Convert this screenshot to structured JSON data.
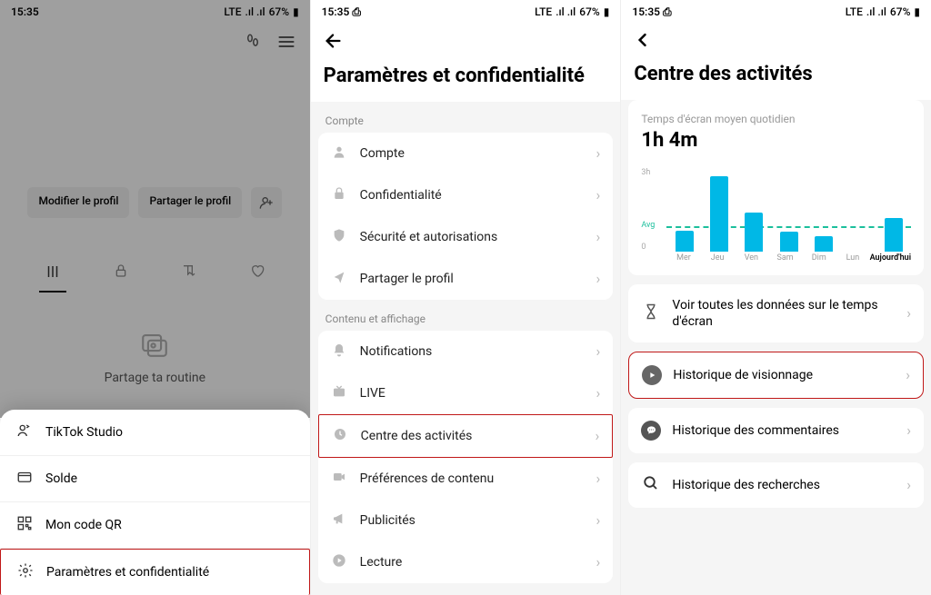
{
  "status": {
    "time": "15:35",
    "time_with_icon": "15:35 ⎙",
    "lte": "LTE",
    "battery": "67%",
    "battery_icon": "▮"
  },
  "panel1": {
    "edit_profile": "Modifier le profil",
    "share_profile": "Partager le profil",
    "tagline": "Partage ta routine",
    "studio": "TikTok Studio",
    "balance": "Solde",
    "qr": "Mon code QR",
    "settings": "Paramètres et confidentialité"
  },
  "panel2": {
    "title": "Paramètres et confidentialité",
    "section_account": "Compte",
    "items_account": [
      "Compte",
      "Confidentialité",
      "Sécurité et autorisations",
      "Partager le profil"
    ],
    "section_content": "Contenu et affichage",
    "items_content": [
      "Notifications",
      "LIVE",
      "Centre des activités",
      "Préférences de contenu",
      "Publicités",
      "Lecture"
    ]
  },
  "panel3": {
    "title": "Centre des activités",
    "avg_label": "Temps d'écran moyen quotidien",
    "avg_value": "1h 4m",
    "see_all": "Voir toutes les données sur le temps d'écran",
    "watch_history": "Historique de visionnage",
    "comment_history": "Historique des commentaires",
    "search_history": "Historique des recherches"
  },
  "chart_data": {
    "type": "bar",
    "categories": [
      "Mer",
      "Jeu",
      "Ven",
      "Sam",
      "Dim",
      "Lun",
      "Aujourd'hui"
    ],
    "values": [
      0.75,
      2.7,
      1.4,
      0.7,
      0.55,
      0,
      1.2
    ],
    "avg_line_value": 1.07,
    "ylabel_ticks": {
      "top": "3h",
      "avg": "Avg",
      "bottom": "0"
    },
    "ylim": [
      0,
      3
    ],
    "title": "Temps d'écran moyen quotidien"
  }
}
